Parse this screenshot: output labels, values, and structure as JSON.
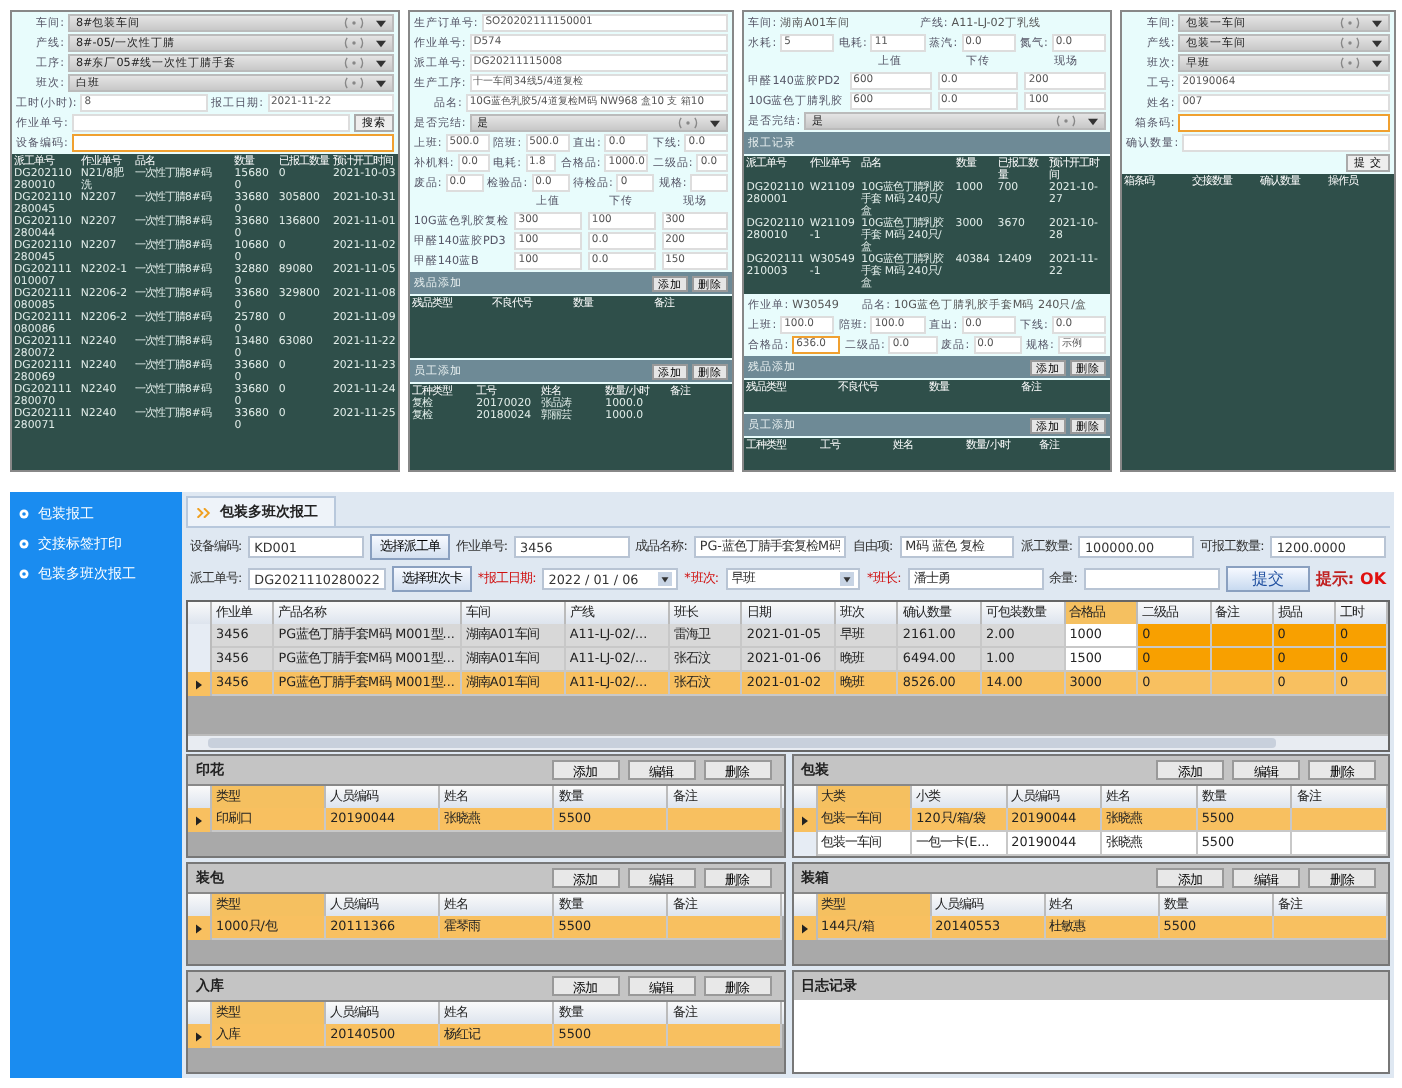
{
  "screens": [
    {
      "items": [
        {
          "kind": "select",
          "label": "车间:",
          "value": "8#包装车间"
        },
        {
          "kind": "select",
          "label": "产线:",
          "value": "8#-05/一次性丁腈"
        },
        {
          "kind": "select",
          "label": "工序:",
          "value": "8#东厂05#线一次性丁腈手套"
        },
        {
          "kind": "select",
          "label": "班次:",
          "value": "白班"
        },
        {
          "kind": "inputs",
          "fields": [
            {
              "label": "工时(小时):",
              "value": "8",
              "focused": false
            },
            {
              "label": "报工日期:",
              "value": "2021-11-22",
              "focused": false
            }
          ]
        },
        {
          "kind": "field",
          "label": "作业单号:",
          "focused": false,
          "button": "搜索"
        },
        {
          "kind": "field",
          "label": "设备编码:",
          "focused": true
        },
        {
          "kind": "table",
          "columns": [
            "派工单号",
            "作业单号",
            "品名",
            "数量",
            "已报工数量",
            "预计开工时间"
          ],
          "rows": [
            [
              "DG202110280010",
              "N21/8肥洗",
              "一次性丁腈8#码",
              "156800",
              "0",
              "2021-10-03"
            ],
            [
              "DG202110280045",
              "N2207",
              "一次性丁腈8#码",
              "336800",
              "305800",
              "2021-10-31"
            ],
            [
              "DG202110280044",
              "N2207",
              "一次性丁腈8#码",
              "336800",
              "136800",
              "2021-11-01"
            ],
            [
              "DG202110280045",
              "N2207",
              "一次性丁腈8#码",
              "106800",
              "0",
              "2021-11-02"
            ],
            [
              "DG202111010007",
              "N2202-1",
              "一次性丁腈8#码",
              "328800",
              "89080",
              "2021-11-05"
            ],
            [
              "DG202111080085",
              "N2206-2",
              "一次性丁腈8#码",
              "336800",
              "329800",
              "2021-11-08"
            ],
            [
              "DG202111080086",
              "N2206-2",
              "一次性丁腈8#码",
              "257800",
              "0",
              "2021-11-09"
            ],
            [
              "DG202111280072",
              "N2240",
              "一次性丁腈8#码",
              "134800",
              "63080",
              "2021-11-22"
            ],
            [
              "DG202111280069",
              "N2240",
              "一次性丁腈8#码",
              "336800",
              "0",
              "2021-11-23"
            ],
            [
              "DG202111280070",
              "N2240",
              "一次性丁腈8#码",
              "336800",
              "0",
              "2021-11-24"
            ],
            [
              "DG202111280071",
              "N2240",
              "一次性丁腈8#码",
              "336800",
              "0",
              "2021-11-25"
            ]
          ]
        }
      ]
    },
    {
      "items": [
        {
          "kind": "field",
          "label": "生产订单号:",
          "value": "SO20202111150001",
          "focused": false
        },
        {
          "kind": "field",
          "label": "作业单号:",
          "value": "D574",
          "focused": false
        },
        {
          "kind": "field",
          "label": "派工单号:",
          "value": "DG20211115008",
          "focused": false
        },
        {
          "kind": "field",
          "label": "生产工序:",
          "value": "十一车间34线5/4道复检",
          "focused": false
        },
        {
          "kind": "field",
          "label": "品名:",
          "value": "10G蓝色乳胶5/4道复检M码 NW968 盒10 支 箱10",
          "focused": false
        },
        {
          "kind": "select",
          "label": "是否完结:",
          "value": "是"
        },
        {
          "kind": "inputs",
          "fields": [
            {
              "label": "上班:",
              "value": "500.0",
              "focused": false
            },
            {
              "label": "陪班:",
              "value": "500.0",
              "focused": false
            },
            {
              "label": "直出:",
              "value": "0.0",
              "focused": false
            },
            {
              "label": "下线:",
              "value": "0.0",
              "focused": false
            }
          ]
        },
        {
          "kind": "inputs",
          "fields": [
            {
              "label": "补机料:",
              "value": "0.0",
              "focused": false
            },
            {
              "label": "电耗:",
              "value": "1.8",
              "focused": false
            },
            {
              "label": "合格品:",
              "value": "1000.0",
              "focused": false
            },
            {
              "label": "二级品:",
              "value": "0.0",
              "focused": false
            }
          ]
        },
        {
          "kind": "inputs",
          "fields": [
            {
              "label": "废品:",
              "value": "0.0",
              "focused": false
            },
            {
              "label": "检验品:",
              "value": "0.0",
              "focused": false
            },
            {
              "label": "待检品:",
              "value": "0",
              "focused": false
            },
            {
              "label": "规格:",
              "focused": false
            }
          ]
        },
        {
          "kind": "matrix",
          "columns": [
            "上值",
            "下传",
            "现场"
          ],
          "rows": [
            {
              "label": "10G蓝色乳胶复检",
              "values": [
                "300",
                "100",
                "300"
              ]
            },
            {
              "label": "甲醛140蓝胶PD3",
              "values": [
                "100",
                "0.0",
                "200"
              ]
            },
            {
              "label": "甲醛140蓝B",
              "values": [
                "100",
                "0.0",
                "150"
              ]
            }
          ]
        },
        {
          "kind": "section",
          "title": "残品添加",
          "buttons": [
            "添加",
            "删除"
          ]
        },
        {
          "kind": "table",
          "columns": [
            "残品类型",
            "不良代号",
            "数量",
            "备注"
          ]
        },
        {
          "kind": "section",
          "title": "员工添加",
          "buttons": [
            "添加",
            "删除"
          ]
        },
        {
          "kind": "table",
          "columns": [
            "工种类型",
            "工号",
            "姓名",
            "数量/小时",
            "备注"
          ],
          "rows": [
            [
              "复检",
              "20170020",
              "张品涛",
              "1000.0",
              null
            ],
            [
              "复检",
              "20180024",
              "郭丽芸",
              "1000.0",
              null
            ]
          ]
        }
      ]
    },
    {
      "items": [
        {
          "kind": "info",
          "fields": [
            {
              "label": "车间:",
              "value": "湖南A01车间"
            },
            {
              "label": "产线:",
              "value": "A11-LJ-02丁乳线"
            }
          ]
        },
        {
          "kind": "inputs",
          "fields": [
            {
              "label": "水耗:",
              "value": "5",
              "focused": false
            },
            {
              "label": "电耗:",
              "value": "11",
              "focused": false
            },
            {
              "label": "蒸汽:",
              "value": "0.0",
              "focused": false
            },
            {
              "label": "氮气:",
              "value": "0.0",
              "focused": false
            }
          ]
        },
        {
          "kind": "matrix",
          "columns": [
            "上值",
            "下传",
            "现场"
          ],
          "rows": [
            {
              "label": "甲醛140蓝胶PD2",
              "values": [
                "600",
                "0.0",
                "200"
              ]
            },
            {
              "label": "10G蓝色丁腈乳胶",
              "values": [
                "600",
                "0.0",
                "100"
              ]
            }
          ]
        },
        {
          "kind": "select",
          "label": "是否完结:",
          "value": "是"
        },
        {
          "kind": "section",
          "title": "报工记录"
        },
        {
          "kind": "table",
          "columns": [
            "派工单号",
            "作业单号",
            "品名",
            "数量",
            "已报工数量",
            "预计开工时间"
          ],
          "rows": [
            [
              "DG202110280001",
              "W21109",
              "10G蓝色丁腈乳胶手套 M码 240只/盒",
              "1000",
              "700",
              "2021-10-27"
            ],
            [
              "DG202110280010",
              "W21109-1",
              "10G蓝色丁腈乳胶手套 M码 240只/盒",
              "3000",
              "3670",
              "2021-10-28"
            ],
            [
              "DG202111210003",
              "W30549-1",
              "10G蓝色丁腈乳胶手套 M码 240只/盒",
              "40384",
              "12409",
              "2021-11-22"
            ]
          ]
        },
        {
          "kind": "info",
          "fields": [
            {
              "label": "作业单:",
              "value": "W30549"
            },
            {
              "label": "品名:",
              "value": "10G蓝色丁腈乳胶手套M码 240只/盒"
            }
          ]
        },
        {
          "kind": "inputs",
          "fields": [
            {
              "label": "上班:",
              "value": "100.0",
              "focused": false
            },
            {
              "label": "陪班:",
              "value": "100.0",
              "focused": false
            },
            {
              "label": "直出:",
              "value": "0.0",
              "focused": false
            },
            {
              "label": "下线:",
              "value": "0.0",
              "focused": false
            }
          ]
        },
        {
          "kind": "inputs",
          "fields": [
            {
              "label": "合格品:",
              "value": "636.0",
              "focused": true
            },
            {
              "label": "二级品:",
              "value": "0.0",
              "focused": false
            },
            {
              "label": "废品:",
              "value": "0.0",
              "focused": false
            },
            {
              "label": "规格:",
              "value": "示例",
              "focused": false
            }
          ]
        },
        {
          "kind": "section",
          "title": "残品添加",
          "buttons": [
            "添加",
            "删除"
          ]
        },
        {
          "kind": "table",
          "columns": [
            "残品类型",
            "不良代号",
            "数量",
            "备注"
          ]
        },
        {
          "kind": "section",
          "title": "员工添加",
          "buttons": [
            "添加",
            "删除"
          ]
        },
        {
          "kind": "table",
          "columns": [
            "工种类型",
            "工号",
            "姓名",
            "数量/小时",
            "备注"
          ]
        }
      ]
    },
    {
      "items": [
        {
          "kind": "select",
          "label": "车间:",
          "value": "包装一车间"
        },
        {
          "kind": "select",
          "label": "产线:",
          "value": "包装一车间"
        },
        {
          "kind": "select",
          "label": "班次:",
          "value": "早班"
        },
        {
          "kind": "field",
          "label": "工号:",
          "value": "20190064",
          "focused": false
        },
        {
          "kind": "field",
          "label": "姓名:",
          "value": "007",
          "focused": false
        },
        {
          "kind": "field",
          "label": "箱条码:",
          "focused": true
        },
        {
          "kind": "field",
          "label": "确认数量:",
          "focused": false
        },
        {
          "kind": "submit",
          "label": "提 交"
        },
        {
          "kind": "table",
          "columns": [
            "箱条码",
            "交接数量",
            "确认数量",
            "操作员"
          ]
        }
      ]
    }
  ],
  "app": {
    "sidebar": {
      "items": [
        {
          "label": "包装报工"
        },
        {
          "label": "交接标签打印"
        },
        {
          "label": "包装多班次报工"
        }
      ]
    },
    "tab": "包装多班次报工",
    "form": [
      [
        {
          "kind": "field",
          "label": "设备编码:",
          "value": "KD001",
          "required": false
        },
        {
          "kind": "button",
          "label": "选择派工单"
        },
        {
          "kind": "field",
          "label": "作业单号:",
          "value": "3456",
          "required": false
        },
        {
          "kind": "field",
          "label": "成品名称:",
          "value": "PG-蓝色丁腈手套复检M码",
          "required": false
        },
        {
          "kind": "field",
          "label": "自由项:",
          "value": "M码 蓝色 复检",
          "required": false
        },
        {
          "kind": "field",
          "label": "派工数量:",
          "value": "100000.00",
          "required": false
        },
        {
          "kind": "field",
          "label": "可报工数量:",
          "value": "1200.0000",
          "required": false
        }
      ],
      [
        {
          "kind": "field",
          "label": "派工单号:",
          "value": "DG2021110280022",
          "required": false
        },
        {
          "kind": "button",
          "label": "选择班次卡"
        },
        {
          "kind": "select",
          "label": "*报工日期:",
          "value": "2022 / 01 / 06",
          "required": true
        },
        {
          "kind": "select",
          "label": "*班次:",
          "value": "早班",
          "required": true
        },
        {
          "kind": "field",
          "label": "*班长:",
          "value": "潘士勇",
          "required": true
        },
        {
          "kind": "field",
          "label": "余量:",
          "required": false
        },
        {
          "kind": "submit",
          "label": "提交"
        },
        {
          "kind": "hint",
          "label": "提示:",
          "value": "OK"
        }
      ]
    ],
    "grid": {
      "columns": [
        {
          "label": "作业单",
          "kind": "text"
        },
        {
          "label": "产品名称",
          "kind": "text"
        },
        {
          "label": "车间",
          "kind": "text"
        },
        {
          "label": "产线",
          "kind": "text"
        },
        {
          "label": "班长",
          "kind": "text"
        },
        {
          "label": "日期",
          "kind": "text"
        },
        {
          "label": "班次",
          "kind": "text"
        },
        {
          "label": "确认数量",
          "kind": "text"
        },
        {
          "label": "可包装数量",
          "kind": "text"
        },
        {
          "label": "合格品",
          "kind": "input"
        },
        {
          "label": "二级品",
          "kind": "flag"
        },
        {
          "label": "备注",
          "kind": "flag"
        },
        {
          "label": "损品",
          "kind": "flag"
        },
        {
          "label": "工时",
          "kind": "flag"
        }
      ],
      "rows": [
        {
          "selected": false,
          "cells": [
            "3456",
            "PG蓝色丁腈手套M码 M001型...",
            "湖南A01车间",
            "A11-LJ-02/...",
            "雷海卫",
            "2021-01-05",
            "早班",
            "2161.00",
            "2.00",
            "1000",
            "0",
            null,
            "0",
            "0"
          ]
        },
        {
          "selected": false,
          "cells": [
            "3456",
            "PG蓝色丁腈手套M码 M001型...",
            "湖南A01车间",
            "A11-LJ-02/...",
            "张石汶",
            "2021-01-06",
            "晚班",
            "6494.00",
            "1.00",
            "1500",
            "0",
            null,
            "0",
            "0"
          ]
        },
        {
          "selected": true,
          "cells": [
            "3456",
            "PG蓝色丁腈手套M码 M001型...",
            "湖南A01车间",
            "A11-LJ-02/...",
            "张石汶",
            "2021-01-02",
            "晚班",
            "8526.00",
            "14.00",
            "3000",
            "0",
            null,
            "0",
            "0"
          ]
        }
      ]
    },
    "panels": [
      {
        "kind": "grid",
        "title": "印花",
        "buttons": [
          "添加",
          "编辑",
          "删除"
        ],
        "columns": [
          "类型",
          "人员编码",
          "姓名",
          "数量",
          "备注"
        ],
        "rows": [
          {
            "selected": true,
            "cells": [
              "印刷口",
              "20190044",
              "张晓燕",
              "5500",
              null
            ]
          }
        ]
      },
      {
        "kind": "grid",
        "title": "包装",
        "buttons": [
          "添加",
          "编辑",
          "删除"
        ],
        "columns": [
          "大类",
          "小类",
          "人员编码",
          "姓名",
          "数量",
          "备注"
        ],
        "rows": [
          {
            "selected": true,
            "cells": [
              "包装一车间",
              "120只/箱/袋",
              "20190044",
              "张晓燕",
              "5500",
              null
            ]
          },
          {
            "selected": false,
            "cells": [
              "包装一车间",
              "一包一卡(E...",
              "20190044",
              "张晓燕",
              "5500",
              null
            ]
          }
        ]
      },
      {
        "kind": "grid",
        "title": "装包",
        "buttons": [
          "添加",
          "编辑",
          "删除"
        ],
        "columns": [
          "类型",
          "人员编码",
          "姓名",
          "数量",
          "备注"
        ],
        "rows": [
          {
            "selected": true,
            "cells": [
              "1000只/包",
              "20111366",
              "霍琴雨",
              "5500",
              null
            ]
          }
        ]
      },
      {
        "kind": "grid",
        "title": "装箱",
        "buttons": [
          "添加",
          "编辑",
          "删除"
        ],
        "columns": [
          "类型",
          "人员编码",
          "姓名",
          "数量",
          "备注"
        ],
        "rows": [
          {
            "selected": true,
            "cells": [
              "144只/箱",
              "20140553",
              "杜敏惠",
              "5500",
              null
            ]
          }
        ]
      },
      {
        "kind": "grid",
        "title": "入库",
        "buttons": [
          "添加",
          "编辑",
          "删除"
        ],
        "columns": [
          "类型",
          "人员编码",
          "姓名",
          "数量",
          "备注"
        ],
        "rows": [
          {
            "selected": true,
            "cells": [
              "入库",
              "20140500",
              "杨红记",
              "5500",
              null
            ]
          }
        ]
      },
      {
        "kind": "log",
        "title": "日志记录"
      }
    ]
  }
}
